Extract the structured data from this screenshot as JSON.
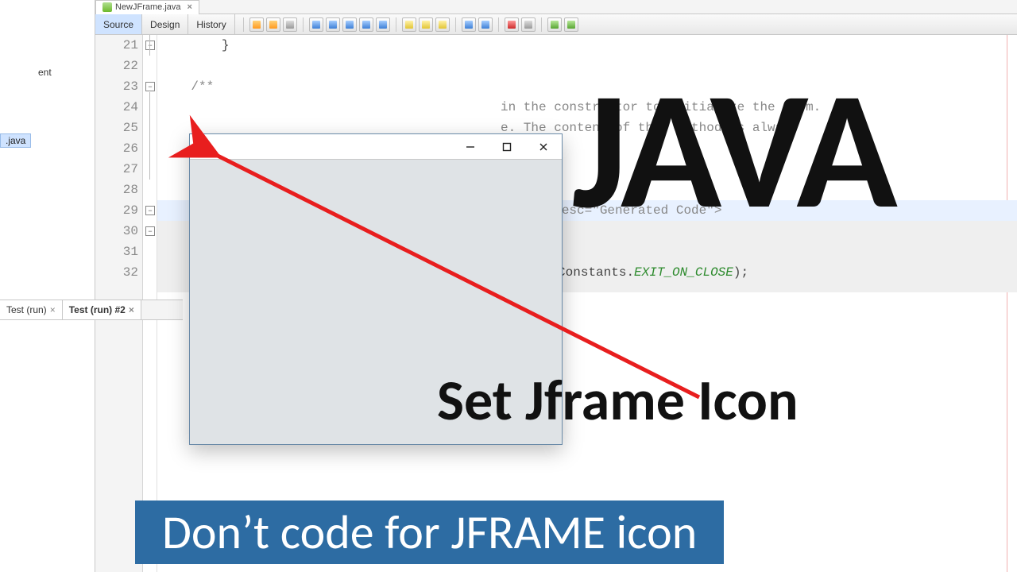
{
  "file_tab": {
    "name": "NewJFrame.java"
  },
  "sidebar": {
    "frag_top": "ent",
    "selected_file": ".java"
  },
  "toolbar": {
    "source": "Source",
    "design": "Design",
    "history": "History"
  },
  "gutter": {
    "lines": [
      "21",
      "22",
      "23",
      "24",
      "25",
      "26",
      "27",
      "28",
      "29",
      "30",
      "31",
      "32"
    ],
    "fold_minus": "−"
  },
  "code": {
    "l21": "        }",
    "l23": "    /**",
    "l24_tail": "in the constructor to initialize the form.",
    "l25_tail": "e. The content of this method is always",
    "l29_tail": "apsed\" desc=\"Generated Code\">",
    "l32_pre": "        swing.WindowConstants.",
    "l32_const": "EXIT_ON_CLOSE",
    "l32_post": ");"
  },
  "output_tabs": {
    "t1": "Test (run)",
    "t2": "Test (run) #2"
  },
  "overlay": {
    "java": "JAVA",
    "set": "Set Jframe Icon",
    "bottom": "Don’t code for JFRAME icon"
  }
}
